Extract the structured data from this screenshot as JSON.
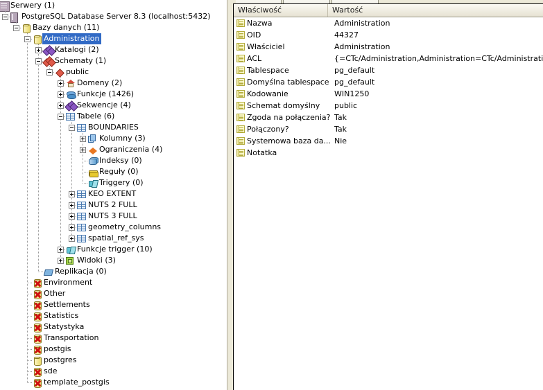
{
  "window": {
    "tabstrip_visible": true
  },
  "tree": {
    "rows": [
      {
        "label": "Serwery (1)",
        "depth": 0,
        "icon": "server-group-icon",
        "toggle": "none",
        "selected": false
      },
      {
        "label": "PostgreSQL Database Server 8.3 (localhost:5432)",
        "depth": 1,
        "icon": "server-icon",
        "toggle": "minus",
        "selected": false
      },
      {
        "label": "Bazy danych (11)",
        "depth": 2,
        "icon": "database-icon",
        "toggle": "minus",
        "selected": false
      },
      {
        "label": "Administration",
        "depth": 3,
        "icon": "database-icon",
        "toggle": "minus",
        "selected": true
      },
      {
        "label": "Katalogi (2)",
        "depth": 4,
        "icon": "catalog-icon",
        "toggle": "plus",
        "selected": false
      },
      {
        "label": "Schematy (1)",
        "depth": 4,
        "icon": "schema-icon",
        "toggle": "minus",
        "selected": false
      },
      {
        "label": "public",
        "depth": 5,
        "icon": "schema-single-icon",
        "toggle": "minus",
        "selected": false
      },
      {
        "label": "Domeny (2)",
        "depth": 6,
        "icon": "domain-icon",
        "toggle": "plus",
        "selected": false
      },
      {
        "label": "Funkcje (1426)",
        "depth": 6,
        "icon": "function-icon",
        "toggle": "plus",
        "selected": false
      },
      {
        "label": "Sekwencje (4)",
        "depth": 6,
        "icon": "sequence-icon",
        "toggle": "plus",
        "selected": false
      },
      {
        "label": "Tabele (6)",
        "depth": 6,
        "icon": "table-icon",
        "toggle": "minus",
        "selected": false
      },
      {
        "label": "BOUNDARIES",
        "depth": 7,
        "icon": "table-icon",
        "toggle": "minus",
        "selected": false
      },
      {
        "label": "Kolumny (3)",
        "depth": 8,
        "icon": "columns-icon",
        "toggle": "plus",
        "selected": false
      },
      {
        "label": "Ograniczenia (4)",
        "depth": 8,
        "icon": "constraint-icon",
        "toggle": "plus",
        "selected": false
      },
      {
        "label": "Indeksy (0)",
        "depth": 8,
        "icon": "index-icon",
        "toggle": "none",
        "selected": false
      },
      {
        "label": "Reguły (0)",
        "depth": 8,
        "icon": "rule-icon",
        "toggle": "none",
        "selected": false
      },
      {
        "label": "Triggery (0)",
        "depth": 8,
        "icon": "trigger-icon",
        "toggle": "none",
        "selected": false
      },
      {
        "label": "KEO EXTENT",
        "depth": 7,
        "icon": "table-icon",
        "toggle": "plus",
        "selected": false
      },
      {
        "label": "NUTS 2 FULL",
        "depth": 7,
        "icon": "table-icon",
        "toggle": "plus",
        "selected": false
      },
      {
        "label": "NUTS 3 FULL",
        "depth": 7,
        "icon": "table-icon",
        "toggle": "plus",
        "selected": false
      },
      {
        "label": "geometry_columns",
        "depth": 7,
        "icon": "table-icon",
        "toggle": "plus",
        "selected": false
      },
      {
        "label": "spatial_ref_sys",
        "depth": 7,
        "icon": "table-icon",
        "toggle": "plus",
        "selected": false
      },
      {
        "label": "Funkcje trigger (10)",
        "depth": 6,
        "icon": "trigger-function-icon",
        "toggle": "plus",
        "selected": false
      },
      {
        "label": "Widoki (3)",
        "depth": 6,
        "icon": "view-icon",
        "toggle": "plus",
        "selected": false
      },
      {
        "label": "Replikacja (0)",
        "depth": 4,
        "icon": "replication-icon",
        "toggle": "none",
        "selected": false
      },
      {
        "label": "Environment",
        "depth": 3,
        "icon": "database-disconnected-icon",
        "toggle": "none",
        "selected": false
      },
      {
        "label": "Other",
        "depth": 3,
        "icon": "database-disconnected-icon",
        "toggle": "none",
        "selected": false
      },
      {
        "label": "Settlements",
        "depth": 3,
        "icon": "database-disconnected-icon",
        "toggle": "none",
        "selected": false
      },
      {
        "label": "Statistics",
        "depth": 3,
        "icon": "database-disconnected-icon",
        "toggle": "none",
        "selected": false
      },
      {
        "label": "Statystyka",
        "depth": 3,
        "icon": "database-disconnected-icon",
        "toggle": "none",
        "selected": false
      },
      {
        "label": "Transportation",
        "depth": 3,
        "icon": "database-disconnected-icon",
        "toggle": "none",
        "selected": false
      },
      {
        "label": "postgis",
        "depth": 3,
        "icon": "database-disconnected-icon",
        "toggle": "none",
        "selected": false
      },
      {
        "label": "postgres",
        "depth": 3,
        "icon": "database-icon",
        "toggle": "none",
        "selected": false
      },
      {
        "label": "sde",
        "depth": 3,
        "icon": "database-disconnected-icon",
        "toggle": "none",
        "selected": false
      },
      {
        "label": "template_postgis",
        "depth": 3,
        "icon": "database-disconnected-icon",
        "toggle": "none",
        "selected": false
      }
    ],
    "selection_color": "#316ac5"
  },
  "properties": {
    "columns": [
      "Właściwość",
      "Wartość"
    ],
    "rows": [
      {
        "name": "Nazwa",
        "value": "Administration"
      },
      {
        "name": "OID",
        "value": "44327"
      },
      {
        "name": "Właściciel",
        "value": "Administration"
      },
      {
        "name": "ACL",
        "value": "{=CTc/Administration,Administration=CTc/Administration}"
      },
      {
        "name": "Tablespace",
        "value": "pg_default"
      },
      {
        "name": "Domyślna tablespace",
        "value": "pg_default"
      },
      {
        "name": "Kodowanie",
        "value": "WIN1250"
      },
      {
        "name": "Schemat domyślny",
        "value": "public"
      },
      {
        "name": "Zgoda na połączenia?",
        "value": "Tak"
      },
      {
        "name": "Połączony?",
        "value": "Tak"
      },
      {
        "name": "Systemowa baza da...",
        "value": "Nie"
      },
      {
        "name": "Notatka",
        "value": ""
      }
    ]
  }
}
